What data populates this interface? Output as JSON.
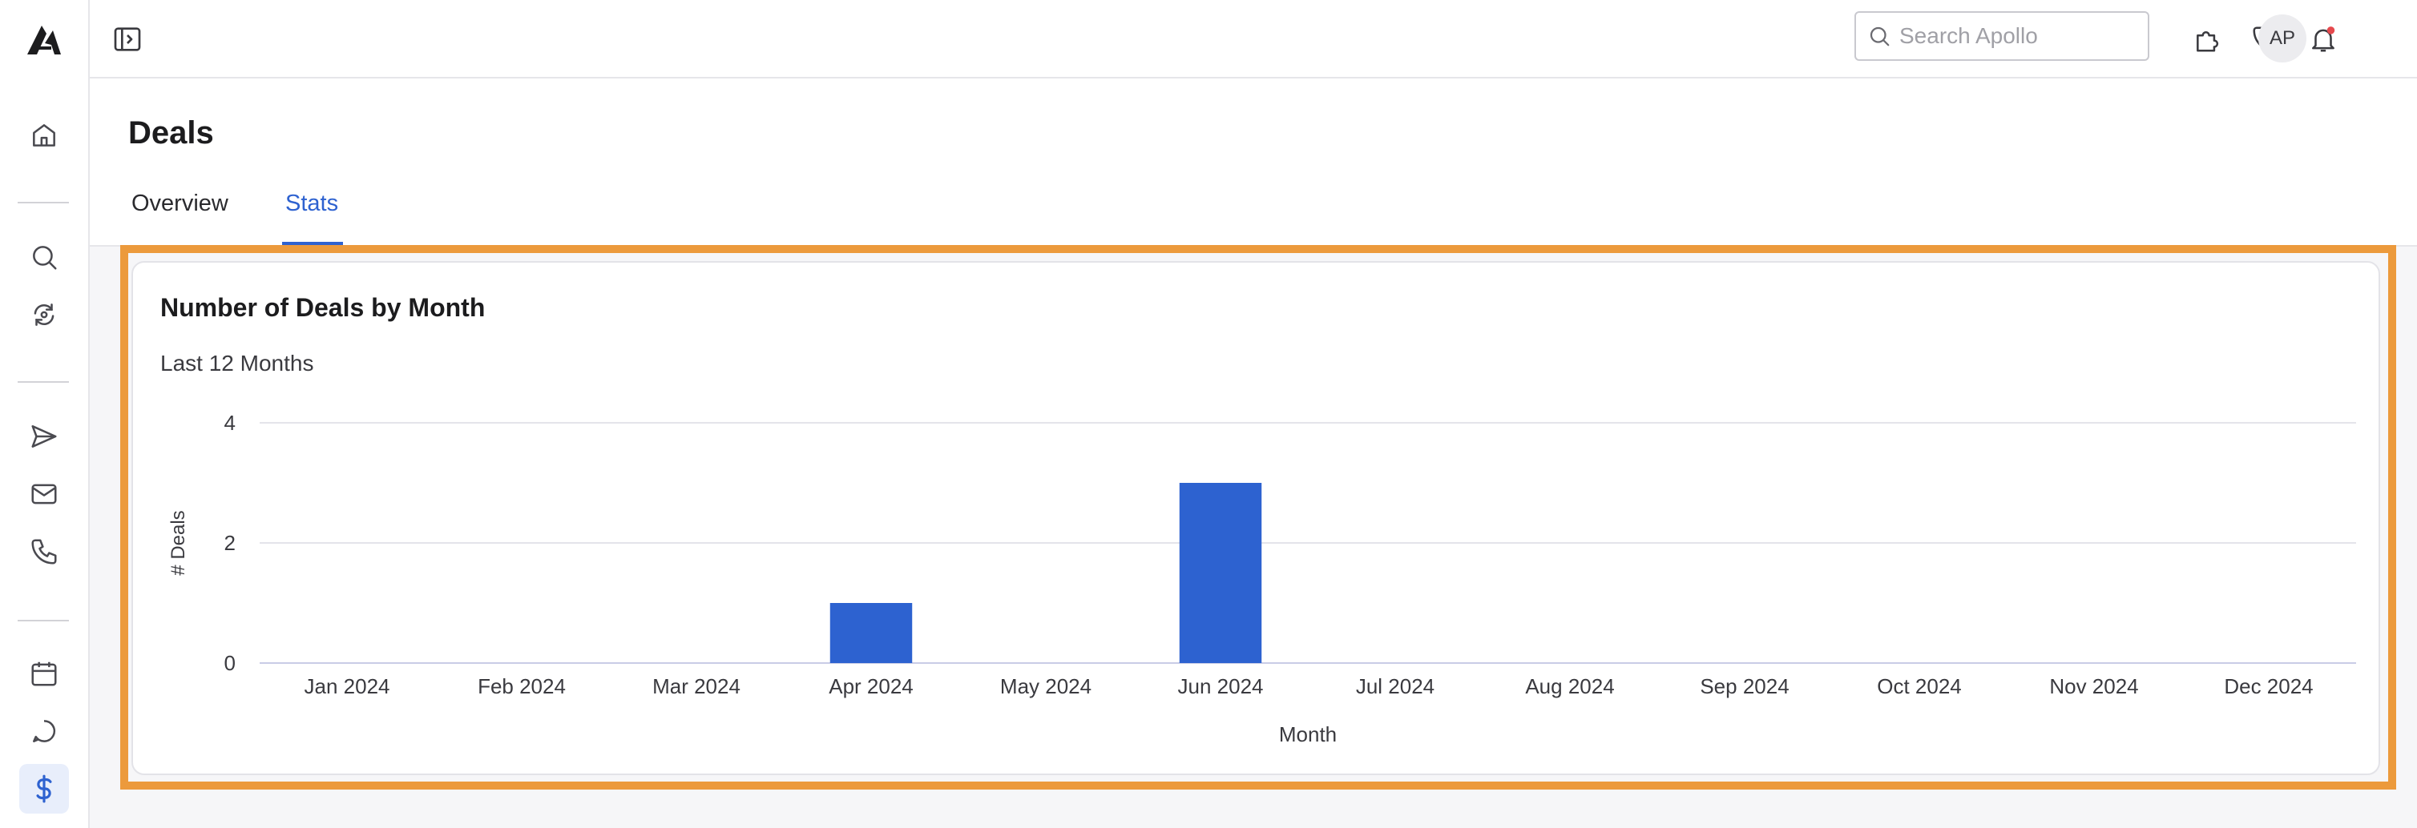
{
  "sidebar": {
    "items": [
      {
        "icon": "home-icon"
      },
      {
        "icon": "search-icon"
      },
      {
        "icon": "sync-icon"
      },
      {
        "icon": "send-icon"
      },
      {
        "icon": "mail-icon"
      },
      {
        "icon": "phone-icon"
      },
      {
        "icon": "calendar-icon"
      },
      {
        "icon": "chat-icon"
      },
      {
        "icon": "dollar-icon",
        "active": true
      }
    ]
  },
  "topbar": {
    "search_placeholder": "Search Apollo",
    "avatar_initials": "AP",
    "notification_dot_color": "#e5484d"
  },
  "page": {
    "title": "Deals",
    "tabs": [
      {
        "label": "Overview",
        "active": false
      },
      {
        "label": "Stats",
        "active": true
      }
    ]
  },
  "card": {
    "title": "Number of Deals by Month",
    "subtitle": "Last 12 Months"
  },
  "colors": {
    "accent": "#2e62d0",
    "bar": "#2d62d0",
    "highlight_border": "#ec9a3c"
  },
  "chart_data": {
    "type": "bar",
    "categories": [
      "Jan 2024",
      "Feb 2024",
      "Mar 2024",
      "Apr 2024",
      "May 2024",
      "Jun 2024",
      "Jul 2024",
      "Aug 2024",
      "Sep 2024",
      "Oct 2024",
      "Nov 2024",
      "Dec 2024"
    ],
    "values": [
      0,
      0,
      0,
      1,
      0,
      3,
      0,
      0,
      0,
      0,
      0,
      0
    ],
    "xlabel": "Month",
    "ylabel": "# Deals",
    "ylim": [
      0,
      4
    ],
    "yticks": [
      0,
      2,
      4
    ],
    "grid": true,
    "legend": "none"
  }
}
